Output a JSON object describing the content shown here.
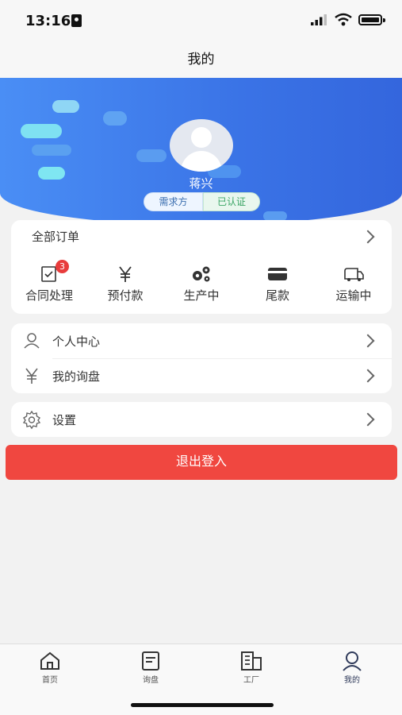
{
  "status_bar": {
    "time": "13:16"
  },
  "nav": {
    "title": "我的"
  },
  "profile": {
    "name": "蒋兴",
    "role": "需求方",
    "verified": "已认证"
  },
  "orders": {
    "header": "全部订单",
    "items": [
      {
        "label": "合同处理",
        "icon": "contract-icon",
        "badge": "3"
      },
      {
        "label": "预付款",
        "icon": "yen-icon"
      },
      {
        "label": "生产中",
        "icon": "gears-icon"
      },
      {
        "label": "尾款",
        "icon": "card-icon"
      },
      {
        "label": "运输中",
        "icon": "truck-icon"
      }
    ]
  },
  "menu": {
    "items": [
      {
        "label": "个人中心",
        "icon": "user-icon"
      },
      {
        "label": "我的询盘",
        "icon": "yen-icon"
      }
    ],
    "settings": {
      "label": "设置",
      "icon": "gear-icon"
    }
  },
  "logout_label": "退出登入",
  "tabbar": {
    "tabs": [
      {
        "label": "首页",
        "icon": "home-icon"
      },
      {
        "label": "询盘",
        "icon": "inquiry-icon"
      },
      {
        "label": "工厂",
        "icon": "factory-icon"
      },
      {
        "label": "我的",
        "icon": "profile-icon",
        "active": true
      }
    ]
  },
  "colors": {
    "accent": "#3a73e6",
    "logout": "#f04740",
    "badge": "#e83c3c",
    "verified": "#3aa565"
  }
}
